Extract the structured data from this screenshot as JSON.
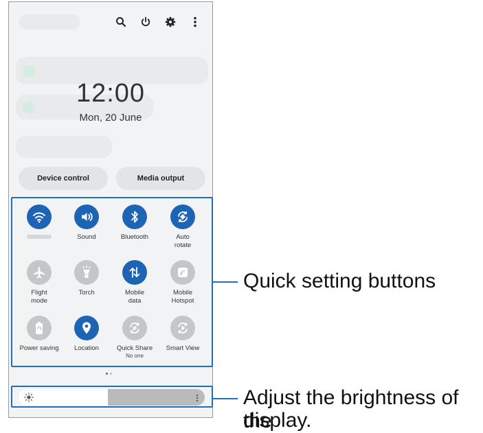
{
  "status": {
    "clock": "12:00",
    "date": "Mon, 20 June"
  },
  "top_icons": [
    "search-icon",
    "power-icon",
    "gear-icon",
    "more-vertical-icon"
  ],
  "buttons": {
    "device_control": "Device control",
    "media_output": "Media output"
  },
  "tiles": [
    {
      "label": "",
      "icon": "wifi-icon",
      "on": true
    },
    {
      "label": "Sound",
      "icon": "sound-icon",
      "on": true
    },
    {
      "label": "Bluetooth",
      "icon": "bluetooth-icon",
      "on": true
    },
    {
      "label": "Auto\nrotate",
      "icon": "auto-rotate-icon",
      "on": true
    },
    {
      "label": "Flight\nmode",
      "icon": "airplane-icon",
      "on": false
    },
    {
      "label": "Torch",
      "icon": "torch-icon",
      "on": false
    },
    {
      "label": "Mobile\ndata",
      "icon": "mobile-data-icon",
      "on": true
    },
    {
      "label": "Mobile\nHotspot",
      "icon": "hotspot-icon",
      "on": false
    },
    {
      "label": "Power saving",
      "icon": "power-saving-icon",
      "on": false
    },
    {
      "label": "Location",
      "icon": "location-icon",
      "on": true
    },
    {
      "label": "Quick Share",
      "sub": "No one",
      "icon": "quick-share-icon",
      "on": false
    },
    {
      "label": "Smart View",
      "icon": "smart-view-icon",
      "on": false
    }
  ],
  "brightness": {
    "level": 0.48
  },
  "callouts": {
    "quick_settings": "Quick setting buttons",
    "brightness_line1": "Adjust the brightness of the",
    "brightness_line2": "display."
  },
  "colors": {
    "accent": "#1e64b4",
    "inactive": "#c4c6c9",
    "callout_border": "#1f6fb8"
  }
}
